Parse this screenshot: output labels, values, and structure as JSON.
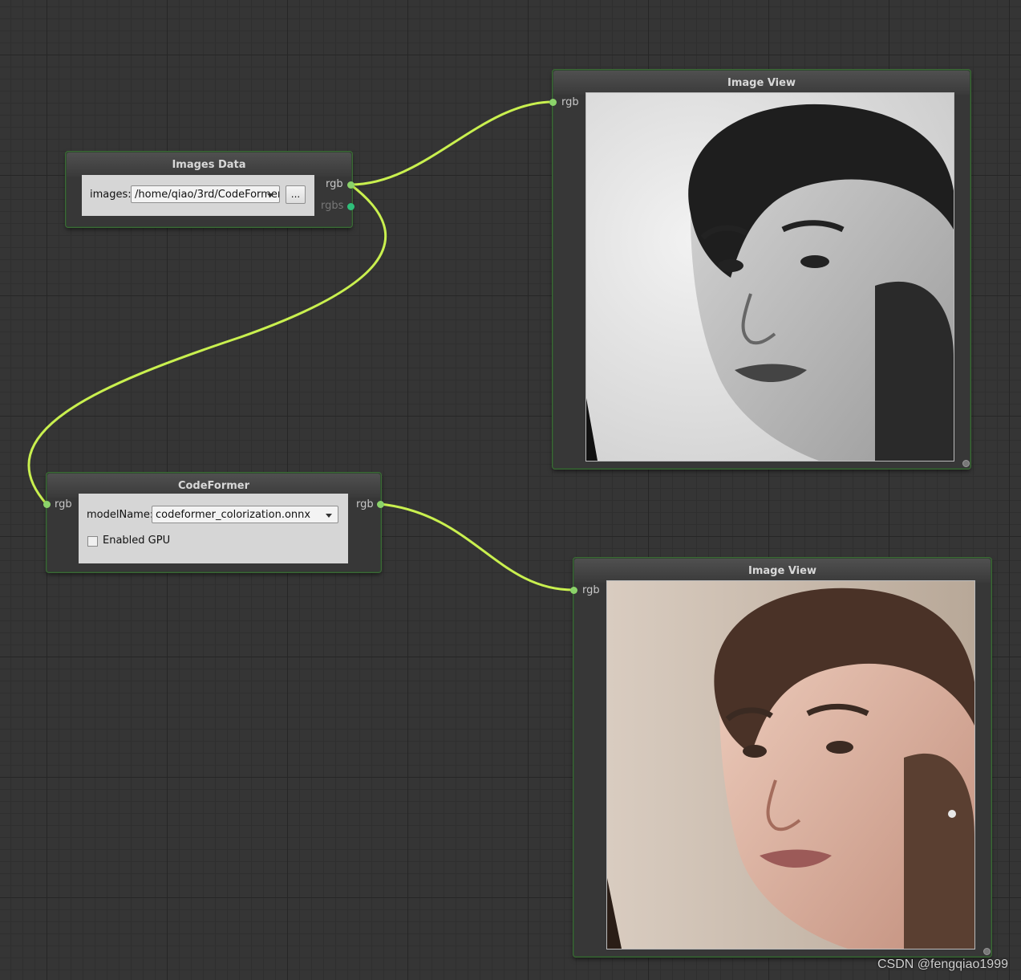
{
  "theme": {
    "wire_color": "#c9f04f",
    "port_color": "#8bd36a",
    "port_secondary_color": "#2fbf7a",
    "canvas_bg": "#353535"
  },
  "nodes": {
    "images_data": {
      "title": "Images Data",
      "images_label": "images:",
      "images_value": "/home/qiao/3rd/CodeFormer",
      "browse_label": "...",
      "out_rgb": "rgb",
      "out_rgbs": "rgbs"
    },
    "image_view_top": {
      "title": "Image View",
      "in_rgb": "rgb",
      "content": "grayscale portrait photo"
    },
    "codeformer": {
      "title": "CodeFormer",
      "in_rgb": "rgb",
      "out_rgb": "rgb",
      "model_label": "modelName:",
      "model_value": "codeformer_colorization.onnx",
      "gpu_label": "Enabled GPU",
      "gpu_enabled": false
    },
    "image_view_bottom": {
      "title": "Image View",
      "in_rgb": "rgb",
      "content": "colorized portrait photo"
    }
  },
  "watermark": "CSDN @fengqiao1999"
}
